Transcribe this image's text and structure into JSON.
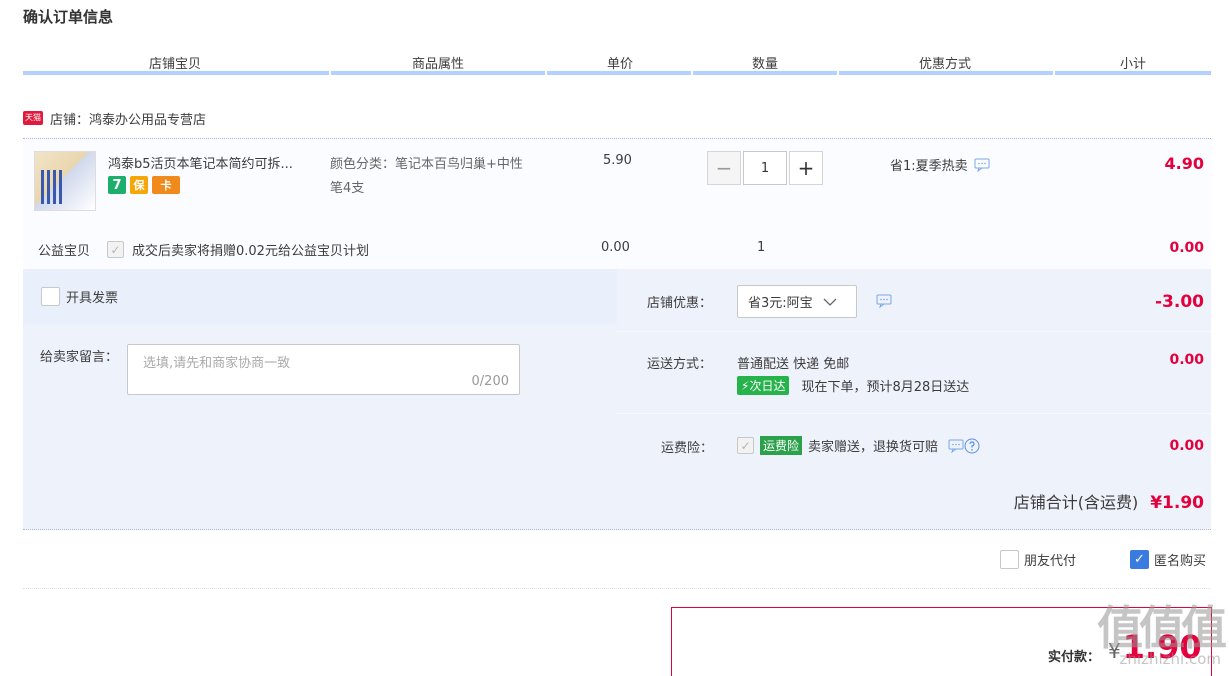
{
  "page_title": "确认订单信息",
  "columns": [
    "店铺宝贝",
    "商品属性",
    "单价",
    "数量",
    "优惠方式",
    "小计"
  ],
  "shop": {
    "badge": "天猫",
    "label": "店铺：鸿泰办公用品专营店"
  },
  "item": {
    "name": "鸿泰b5活页本笔记本简约可拆...",
    "tags": [
      "7",
      "保",
      "卡"
    ],
    "attr_line1": "颜色分类：笔记本百鸟归巢+中性",
    "attr_line2": "笔4支",
    "price": "5.90",
    "quantity": "1",
    "qty_minus": "−",
    "qty_plus": "+",
    "promo": "省1:夏季热卖",
    "subtotal": "4.90"
  },
  "charity": {
    "label": "公益宝贝",
    "text": "成交后卖家将捐赠0.02元给公益宝贝计划",
    "price": "0.00",
    "quantity": "1",
    "subtotal": "0.00"
  },
  "invoice": {
    "label": "开具发票"
  },
  "message": {
    "label": "给卖家留言：",
    "placeholder": "选填,请先和商家协商一致",
    "counter": "0/200"
  },
  "shop_discount": {
    "label": "店铺优惠：",
    "selected": "省3元:阿宝",
    "amount": "-3.00"
  },
  "shipping": {
    "label": "运送方式：",
    "method": "普通配送 快递 免邮",
    "badge": "次日达",
    "eta": "现在下单，预计8月28日送达",
    "amount": "0.00"
  },
  "insurance": {
    "label": "运费险：",
    "badge": "运费险",
    "text": "卖家赠送，退换货可赔",
    "amount": "0.00"
  },
  "shop_total": {
    "label": "店铺合计(含运费)",
    "amount": "¥1.90"
  },
  "options": {
    "friend_pay": "朋友代付",
    "anonymous": "匿名购买"
  },
  "payment": {
    "label": "实付款：",
    "currency": "¥",
    "amount": "1.90"
  },
  "watermark": {
    "logo": "值值值",
    "site": "zhizhizhi.com"
  },
  "colors": {
    "accent_red": "#e4003c",
    "header_bar": "#b2d1ff",
    "panel_bg": "#eef2fb",
    "check_blue": "#3a7be0"
  }
}
